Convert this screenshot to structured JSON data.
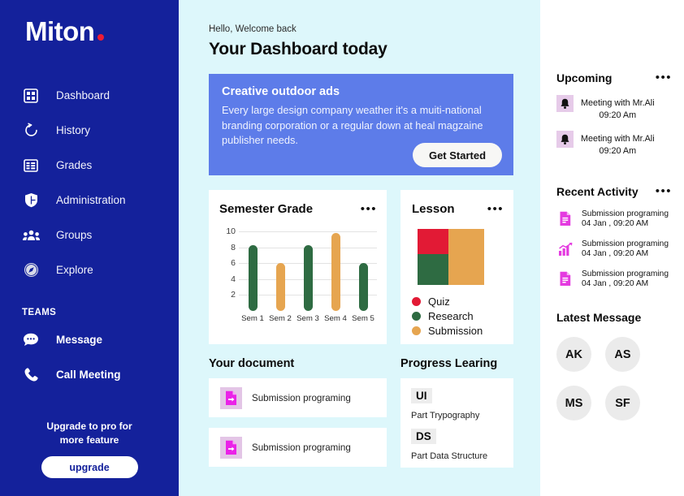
{
  "sidebar": {
    "logo": {
      "text": "Miton",
      "dot_color": "#ED1C35"
    },
    "nav_items": [
      {
        "label": "Dashboard",
        "icon": "grid-icon"
      },
      {
        "label": "History",
        "icon": "history-icon"
      },
      {
        "label": "Grades",
        "icon": "grades-icon"
      },
      {
        "label": "Administration",
        "icon": "shield-icon"
      },
      {
        "label": "Groups",
        "icon": "people-icon"
      },
      {
        "label": "Explore",
        "icon": "compass-icon"
      }
    ],
    "teams_heading": "TEAMS",
    "team_items": [
      {
        "label": "Message",
        "icon": "chat-icon"
      },
      {
        "label": "Call Meeting",
        "icon": "phone-icon"
      }
    ],
    "upgrade": {
      "line1": "Upgrade to pro for",
      "line2": "more feature",
      "button_label": "upgrade"
    },
    "bg_color": "#14219B"
  },
  "main": {
    "greeting": "Hello, Welcome back",
    "page_title": "Your Dashboard today",
    "banner": {
      "title": "Creative outdoor ads",
      "body": "Every large design company weather it's a muiti-national branding corporation or a regular down at heal magzaine publisher needs.",
      "button_label": "Get Started",
      "bg_color": "#5D7CE9"
    },
    "grade_card": {
      "title": "Semester Grade",
      "menu": "•••"
    },
    "lesson_card": {
      "title": "Lesson",
      "menu": "•••"
    },
    "documents": {
      "title": "Your document",
      "items": [
        {
          "label": "Submission programing",
          "icon": "document-export-icon"
        },
        {
          "label": "Submission programing",
          "icon": "document-export-icon"
        }
      ]
    },
    "progress": {
      "title": "Progress Learing",
      "items": [
        {
          "tag": "UI",
          "subtitle": "Part Trypography"
        },
        {
          "tag": "DS",
          "subtitle": "Part Data Structure"
        }
      ]
    }
  },
  "right_panel": {
    "upcoming": {
      "title": "Upcoming",
      "menu": "•••",
      "items": [
        {
          "title": "Meeting with Mr.Ali",
          "time": "09:20 Am",
          "icon": "bell-icon"
        },
        {
          "title": "Meeting with Mr.Ali",
          "time": "09:20 Am",
          "icon": "bell-icon"
        }
      ]
    },
    "recent_activity": {
      "title": "Recent Activity",
      "menu": "•••",
      "items": [
        {
          "title": "Submission programing",
          "time": "04 Jan , 09:20 AM",
          "icon": "document-icon"
        },
        {
          "title": "Submission programing",
          "time": "04 Jan , 09:20 AM",
          "icon": "bar-chart-icon"
        },
        {
          "title": "Submission programing",
          "time": "04 Jan , 09:20 AM",
          "icon": "document-icon"
        }
      ]
    },
    "latest_message": {
      "title": "Latest Message",
      "avatars": [
        "AK",
        "AS",
        "MS",
        "SF"
      ]
    }
  },
  "chart_data": [
    {
      "type": "bar",
      "title": "Semester Grade",
      "categories": [
        "Sem 1",
        "Sem 2",
        "Sem 3",
        "Sem 4",
        "Sem 5"
      ],
      "values": [
        8.3,
        6.0,
        8.3,
        9.8,
        6.0
      ],
      "bar_colors": [
        "#2E6B42",
        "#E6A550",
        "#2E6B42",
        "#E6A550",
        "#2E6B42"
      ],
      "ylim": [
        0,
        10.6
      ],
      "yticks": [
        10,
        8,
        6,
        4,
        2
      ],
      "xlabel": "",
      "ylabel": "",
      "grid": true,
      "legend": "none"
    },
    {
      "type": "treemap",
      "title": "Lesson",
      "categories": [
        "Quiz",
        "Research",
        "Submission"
      ],
      "values": [
        21,
        25,
        54
      ],
      "colors": [
        "#E21A35",
        "#2E6B42",
        "#E6A550"
      ],
      "legend": "bottom-left"
    }
  ]
}
